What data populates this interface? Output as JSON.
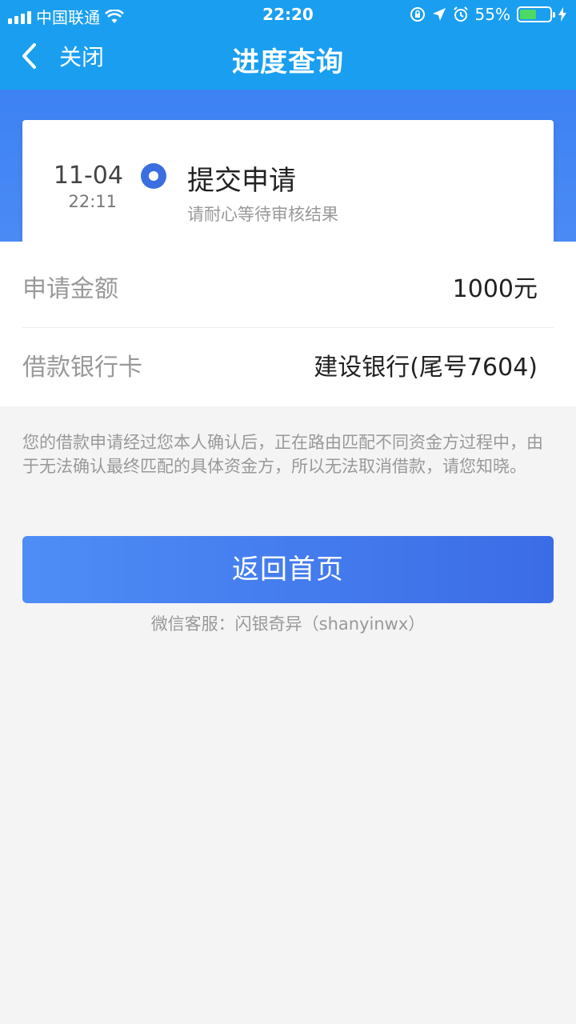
{
  "status_bar": {
    "carrier": "中国联通",
    "time": "22:20",
    "battery_percent": "55%",
    "battery_level": 0.55,
    "icons": [
      "signal-icon",
      "wifi-icon",
      "orientation-lock-icon",
      "location-icon",
      "alarm-icon",
      "battery-icon",
      "charging-icon"
    ]
  },
  "nav": {
    "back_label": "关闭",
    "title": "进度查询"
  },
  "progress": {
    "date": "11-04",
    "time": "22:11",
    "step_title": "提交申请",
    "step_subtitle": "请耐心等待审核结果"
  },
  "info": {
    "amount_label": "申请金额",
    "amount_value": "1000元",
    "card_label": "借款银行卡",
    "card_value": "建设银行(尾号7604)"
  },
  "notice": "您的借款申请经过您本人确认后，正在路由匹配不同资金方过程中，由于无法确认最终匹配的具体资金方，所以无法取消借款，请您知晓。",
  "actions": {
    "home_button": "返回首页"
  },
  "service_text": "微信客服：闪银奇异（shanyinwx）",
  "colors": {
    "header": "#1a9ff0",
    "band": "#3d82f3",
    "accent": "#3b6fe0",
    "button_start": "#4e8df6",
    "button_end": "#3b6ce6"
  }
}
